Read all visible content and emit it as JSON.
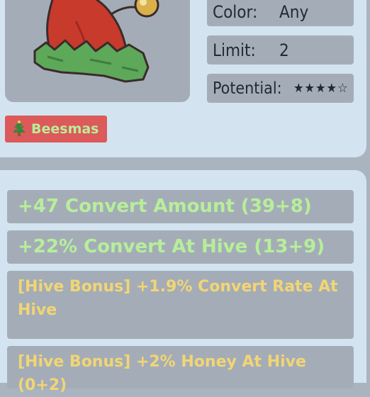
{
  "item": {
    "image_icon": "elf-hat-icon"
  },
  "stats": {
    "color_label": "Color:",
    "color_value": "Any",
    "limit_label": "Limit:",
    "limit_value": "2",
    "potential_label": "Potential:",
    "potential_stars": "★★★★☆",
    "potential_rating": 4,
    "potential_max": 5
  },
  "event": {
    "icon": "christmas-tree-icon",
    "label": "Beesmas"
  },
  "abilities": [
    {
      "text": "+47 Convert Amount (39+8)"
    },
    {
      "text": "+22% Convert At Hive (13+9)"
    },
    {
      "text": "[Hive Bonus] +1.9% Convert Rate At Hive"
    },
    {
      "text": "[Hive Bonus] +2% Honey At Hive (0+2)"
    }
  ],
  "colors": {
    "panel": "#d3e4f0",
    "box": "#a4adb7",
    "green_text": "#b7ee9a",
    "yellow_text": "#f2d574",
    "event_tag": "#dc5a5a"
  }
}
